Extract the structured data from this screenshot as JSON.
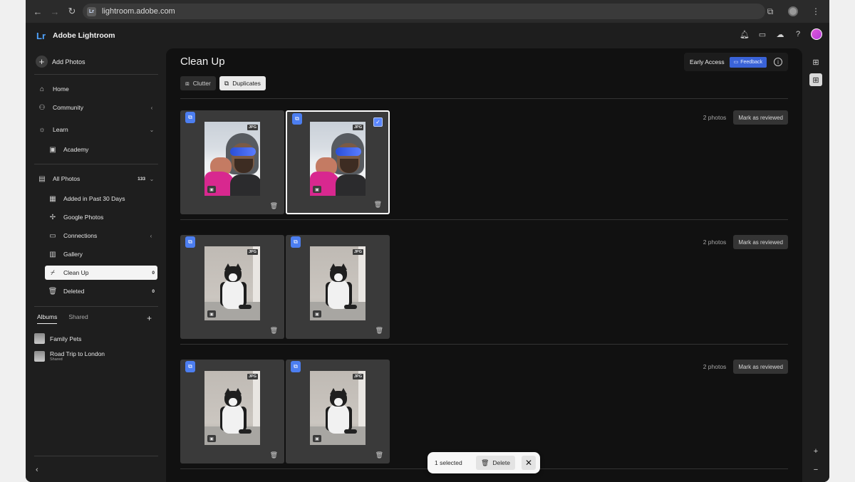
{
  "browser": {
    "url": "lightroom.adobe.com"
  },
  "app": {
    "logo": "Lr",
    "title": "Adobe Lightroom"
  },
  "sidebar": {
    "add_photos": "Add Photos",
    "nav": {
      "home": "Home",
      "community": "Community",
      "learn": "Learn",
      "academy": "Academy",
      "all_photos": "All Photos",
      "all_photos_count": "133",
      "added_recent": "Added in Past 30 Days",
      "google_photos": "Google Photos",
      "connections": "Connections",
      "gallery": "Gallery",
      "clean_up": "Clean Up",
      "clean_up_count": "0",
      "deleted": "Deleted",
      "deleted_count": "0"
    },
    "albums_tabs": {
      "albums": "Albums",
      "shared": "Shared"
    },
    "albums": [
      {
        "name": "Family Pets",
        "sub": ""
      },
      {
        "name": "Road Trip to London",
        "sub": "Shared"
      }
    ]
  },
  "main": {
    "title": "Clean Up",
    "tabs": {
      "clutter": "Clutter",
      "duplicates": "Duplicates"
    },
    "early_access": "Early Access",
    "feedback": "Feedback",
    "groups": [
      {
        "count": "2 photos",
        "review": "Mark as reviewed"
      },
      {
        "count": "2 photos",
        "review": "Mark as reviewed"
      },
      {
        "count": "2 photos",
        "review": "Mark as reviewed"
      }
    ],
    "file_type": "JPG"
  },
  "selection_bar": {
    "selected": "1 selected",
    "delete": "Delete"
  },
  "colors": {
    "accent": "#4c7ef0",
    "feedback": "#3a63d8",
    "background": "#111111"
  }
}
